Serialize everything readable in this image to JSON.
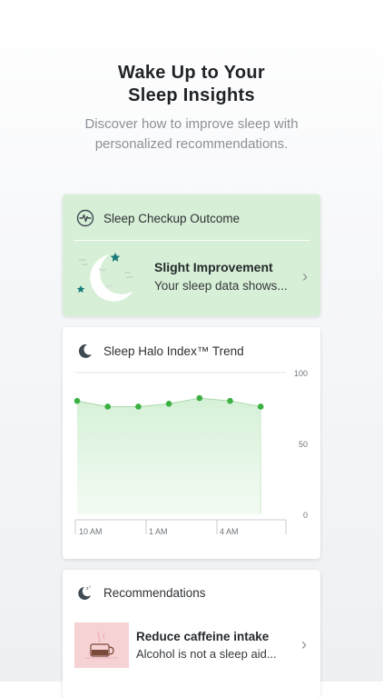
{
  "hero": {
    "title_line1": "Wake Up to Your",
    "title_line2": "Sleep Insights",
    "subtitle_line1": "Discover how to improve sleep with",
    "subtitle_line2": "personalized recommendations."
  },
  "checkup": {
    "header": "Sleep Checkup Outcome",
    "title": "Slight Improvement",
    "subtitle": "Your sleep data shows...",
    "icon": "pulse-icon"
  },
  "trend": {
    "header": "Sleep Halo Index™ Trend",
    "icon": "moon-icon",
    "chart_data": {
      "type": "area",
      "x": [
        "10 AM",
        "",
        "",
        "1 AM",
        "",
        "4 AM",
        ""
      ],
      "x_ticks": [
        "10 AM",
        "1 AM",
        "4 AM"
      ],
      "values": [
        80,
        76,
        76,
        78,
        82,
        80,
        76
      ],
      "ylim": [
        0,
        100
      ],
      "y_ticks": [
        "100",
        "50",
        "0"
      ],
      "colors": {
        "line": "#3cb043",
        "fill": "#d6f1d8",
        "point": "#3cb043"
      }
    }
  },
  "recommendations": {
    "header": "Recommendations",
    "icon": "sleep-zz-icon",
    "items": [
      {
        "title": "Reduce caffeine intake",
        "subtitle": "Alcohol is not a sleep aid..."
      }
    ]
  },
  "colors": {
    "checkup_bg": "#d7efd6",
    "accent": "#3cb043",
    "star": "#1b7b7b"
  }
}
